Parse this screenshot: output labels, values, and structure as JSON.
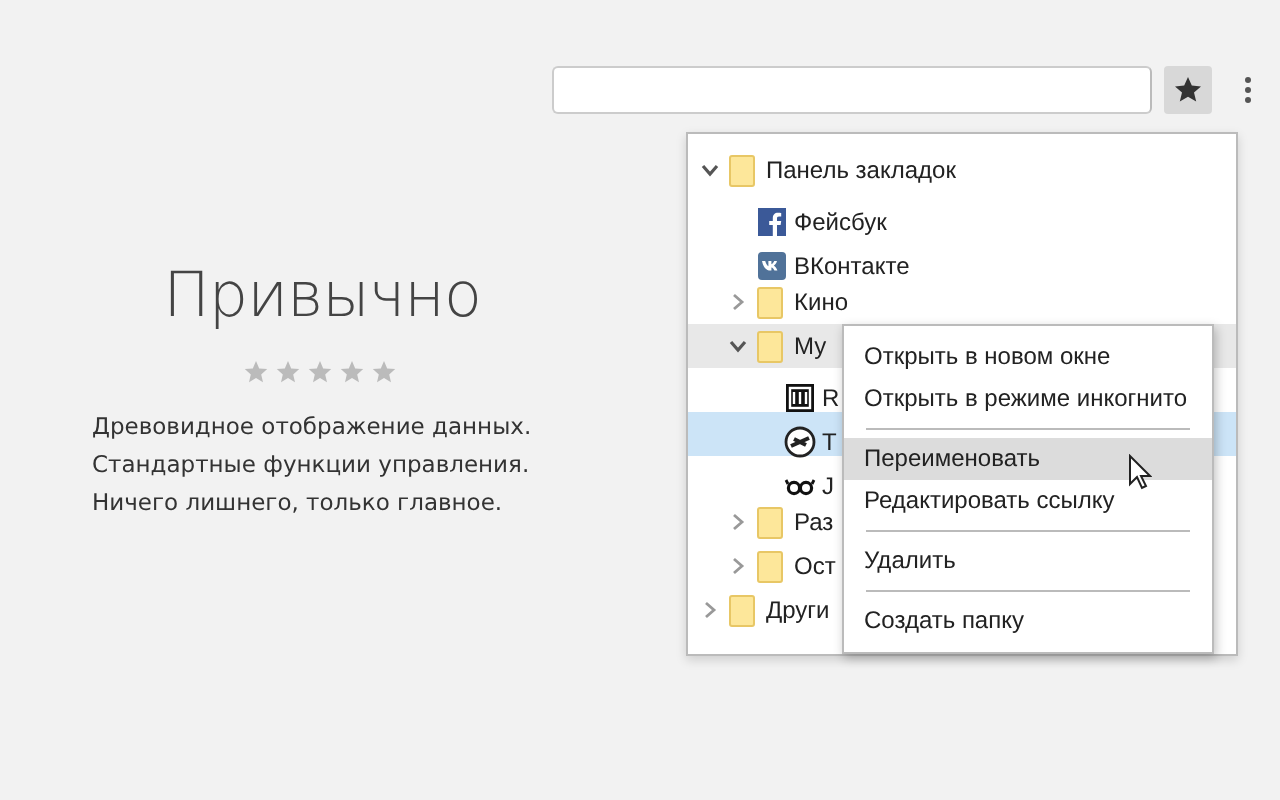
{
  "toolbar": {
    "bookmark_button": {
      "active": true
    }
  },
  "promo": {
    "title": "Привычно",
    "lines": [
      "Древовидное отображение данных.",
      "Стандартные функции управления.",
      "Ничего лишнего, только главное."
    ]
  },
  "bookmarks": [
    {
      "kind": "folder",
      "label": "Панель закладок",
      "expanded": true,
      "selected": false,
      "highlighted": false,
      "children": [
        {
          "kind": "facebook",
          "label": "Фейсбук",
          "selected": false,
          "highlighted": false
        },
        {
          "kind": "vkontakte",
          "label": "ВКонтакте",
          "selected": false,
          "highlighted": false
        },
        {
          "kind": "folder",
          "label": "Кино",
          "expanded": false,
          "selected": false,
          "highlighted": false
        },
        {
          "kind": "folder",
          "label": "Му",
          "expanded": true,
          "selected": false,
          "highlighted": true,
          "children": [
            {
              "kind": "square-logo",
              "label": "R",
              "selected": false,
              "highlighted": false
            },
            {
              "kind": "round-logo",
              "label": "Т",
              "selected": true,
              "highlighted": false
            },
            {
              "kind": "glasses",
              "label": "J",
              "selected": false,
              "highlighted": false
            }
          ]
        },
        {
          "kind": "folder",
          "label": "Раз",
          "expanded": false,
          "selected": false,
          "highlighted": false
        },
        {
          "kind": "folder",
          "label": "Ост",
          "expanded": false,
          "selected": false,
          "highlighted": false
        }
      ]
    },
    {
      "kind": "folder",
      "label": "Други",
      "expanded": false,
      "selected": false,
      "highlighted": false
    }
  ],
  "context_menu": [
    {
      "kind": "item",
      "label": "Открыть в новом окне",
      "hovered": false
    },
    {
      "kind": "item",
      "label": "Открыть в режиме инкогнито",
      "hovered": false
    },
    {
      "kind": "separator"
    },
    {
      "kind": "item",
      "label": "Переименовать",
      "hovered": true
    },
    {
      "kind": "item",
      "label": "Редактировать ссылку",
      "hovered": false
    },
    {
      "kind": "separator"
    },
    {
      "kind": "item",
      "label": "Удалить",
      "hovered": false
    },
    {
      "kind": "separator"
    },
    {
      "kind": "item",
      "label": "Создать папку",
      "hovered": false
    }
  ]
}
